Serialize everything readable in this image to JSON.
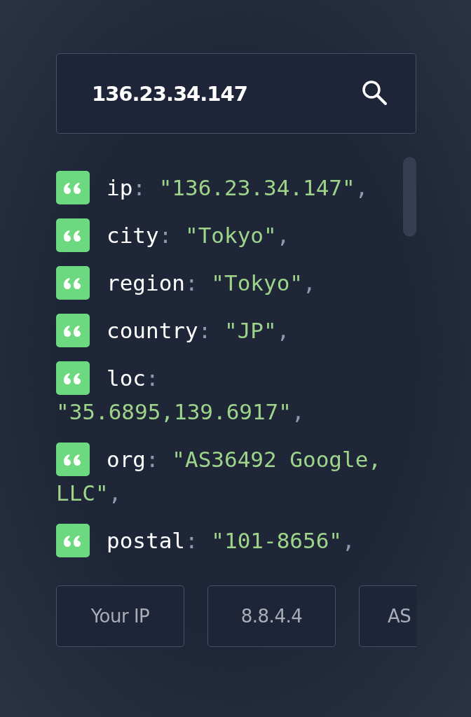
{
  "search": {
    "value": "136.23.34.147"
  },
  "entries": [
    {
      "key": "ip",
      "colon": ":",
      "value": [
        "\"136.23.34.147\""
      ],
      "comma": ","
    },
    {
      "key": "city",
      "colon": ":",
      "value": [
        "\"Tokyo\""
      ],
      "comma": ","
    },
    {
      "key": "region",
      "colon": ":",
      "value": [
        "\"Tokyo\""
      ],
      "comma": ","
    },
    {
      "key": "country",
      "colon": ":",
      "value": [
        "\"JP\""
      ],
      "comma": ","
    },
    {
      "key": "loc",
      "colon": ":",
      "value": [
        "\"35.6895,139.6917\""
      ],
      "comma": ","
    },
    {
      "key": "org",
      "colon": ":",
      "value": [
        "\"AS36492 Google,",
        "LLC\""
      ],
      "comma": ","
    },
    {
      "key": "postal",
      "colon": ":",
      "value": [
        "\"101-8656\""
      ],
      "comma": ","
    }
  ],
  "buttons": [
    "Your IP",
    "8.8.4.4",
    "AS"
  ]
}
